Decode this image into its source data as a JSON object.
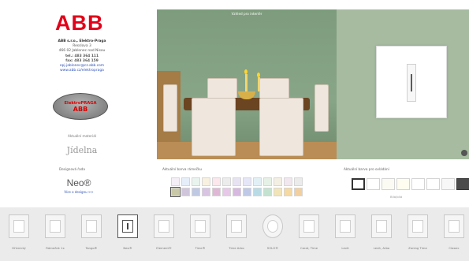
{
  "brand": {
    "logo": "ABB",
    "company": "ABB s.r.o., Elektro-Praga",
    "street": "Resslova 3",
    "city": "466 02 Jablonec nad Nisou",
    "tel": "tel.: 483 364 111",
    "fax": "fax: 483 364 159",
    "email": "epj.jablonec@cz.abb.com",
    "web": "www.abb.cz/elektropraga",
    "badge_top": "ElektroPRAGA",
    "badge_bottom": "ABB"
  },
  "technology": {
    "label": "Aktuální materiál",
    "name": "Jídelna"
  },
  "room": {
    "title": "Vzhled pro interiér"
  },
  "design": {
    "label": "Designová řada",
    "name": "Neo®",
    "link": "Více o designu >>"
  },
  "colors": {
    "label": "Aktuální barva rámečku",
    "swatches": [
      "#f4eef6",
      "#e6eef9",
      "#e9f4ef",
      "#f8f1e0",
      "#fbe7ec",
      "#ececec",
      "#e8e3f3",
      "#e5e6f7",
      "#e2f0f6",
      "#e6f1e6",
      "#f4efe3",
      "#f2e7ee",
      "#ebebeb",
      "#c9c8a8",
      "#cfc6dc",
      "#c0c9e4",
      "#d9c4e4",
      "#e0b7d4",
      "#e8c8e9",
      "#d7b8e0",
      "#bfc8e6",
      "#b9dbe6",
      "#c3e2cf",
      "#f2e4b6",
      "#f5d9a0",
      "#f2cf9e"
    ],
    "selected_index": 13
  },
  "inserts": {
    "label": "Aktuální barva pro ovládání",
    "sublabel": "Bílá/bílá",
    "items": [
      "#ffffff",
      "#ffffff",
      "#fbfbf4",
      "#fffdf0",
      "#ffffff",
      "#ffffff",
      "#f7f7f7",
      "#4a4a4a"
    ],
    "selected_index": 0
  },
  "frames": [
    {
      "label": "Hřívnický"
    },
    {
      "label": "Rámeček 1x"
    },
    {
      "label": "Tango®"
    },
    {
      "label": "Neo®"
    },
    {
      "label": "Element®"
    },
    {
      "label": "Time®"
    },
    {
      "label": "Time Arbo"
    },
    {
      "label": "SOLO®"
    },
    {
      "label": "Carat, Time"
    },
    {
      "label": "Levit"
    },
    {
      "label": "Levit, Arbo"
    },
    {
      "label": "Zoning Time"
    },
    {
      "label": "Classic"
    }
  ],
  "frames_selected_index": 3,
  "frames_round_index": 7
}
